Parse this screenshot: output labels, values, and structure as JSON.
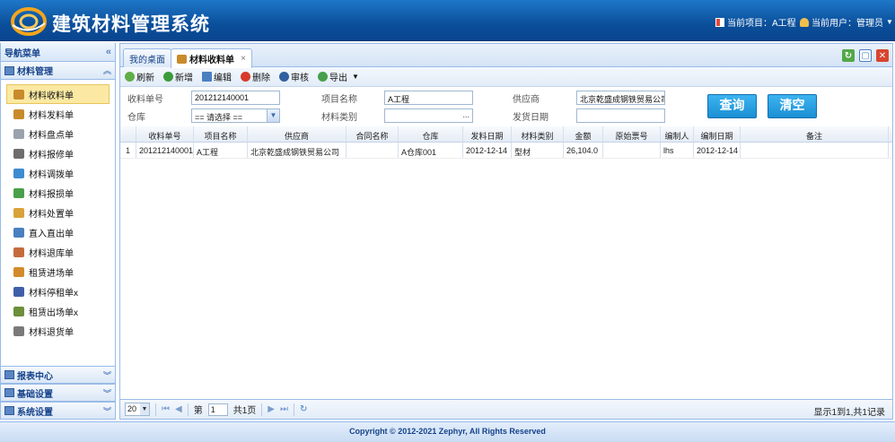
{
  "header": {
    "app_title": "建筑材料管理系统",
    "current_project": "当前项目：A工程",
    "current_user": "当前用户：管理员"
  },
  "nav": {
    "title": "导航菜单",
    "active_group": "材料管理",
    "items": [
      {
        "label": "材料收料单",
        "color": "#c98a2b"
      },
      {
        "label": "材料发料单",
        "color": "#c98a2b"
      },
      {
        "label": "材料盘点单",
        "color": "#9aa3ad"
      },
      {
        "label": "材料报修单",
        "color": "#6d6d6d"
      },
      {
        "label": "材料调拨单",
        "color": "#3d8bd0"
      },
      {
        "label": "材料报损单",
        "color": "#4aa04a"
      },
      {
        "label": "材料处置单",
        "color": "#d9a23a"
      },
      {
        "label": "直入直出单",
        "color": "#4a7fc0"
      },
      {
        "label": "材料退库单",
        "color": "#c46c3c"
      },
      {
        "label": "租赁进场单",
        "color": "#d28b2a"
      },
      {
        "label": "材料停租单x",
        "color": "#3f5fa8"
      },
      {
        "label": "租赁出场单x",
        "color": "#6b8f3a"
      },
      {
        "label": "材料退货单",
        "color": "#7a7a7a"
      }
    ],
    "bottom_groups": [
      "报表中心",
      "基础设置",
      "系统设置"
    ]
  },
  "tabs": {
    "home": "我的桌面",
    "active": "材料收料单"
  },
  "toolbar": {
    "refresh": "刷新",
    "add": "新增",
    "edit": "编辑",
    "delete": "删除",
    "audit": "审核",
    "export": "导出"
  },
  "form": {
    "receipt_no_label": "收料单号",
    "receipt_no_value": "201212140001",
    "project_label": "项目名称",
    "project_value": "A工程",
    "supplier_label": "供应商",
    "supplier_value": "北京乾盛成钢铁贸易公司",
    "warehouse_label": "仓库",
    "warehouse_value": "== 请选择 ==",
    "category_label": "材料类别",
    "category_value": "",
    "date_label": "发货日期",
    "date_value": "",
    "query_button": "查询",
    "clear_button": "清空"
  },
  "table": {
    "columns": [
      "收料单号",
      "项目名称",
      "供应商",
      "合同名称",
      "仓库",
      "发料日期",
      "材料类别",
      "金额",
      "原始票号",
      "编制人",
      "编制日期",
      "备注"
    ],
    "rows": [
      {
        "rownum": "1",
        "cells": [
          "201212140001",
          "A工程",
          "北京乾盛成钢铁贸易公司",
          "",
          "A仓库001",
          "2012-12-14",
          "型材",
          "26,104.0",
          "",
          "lhs",
          "2012-12-14",
          ""
        ]
      }
    ]
  },
  "pager": {
    "page_size": "20",
    "page_prefix": "第",
    "page_value": "1",
    "page_suffix": "共1页",
    "info": "显示1到1,共1记录"
  },
  "footer": {
    "copyright": "Copyright © 2012-2021 Zephyr, All Rights Reserved"
  }
}
